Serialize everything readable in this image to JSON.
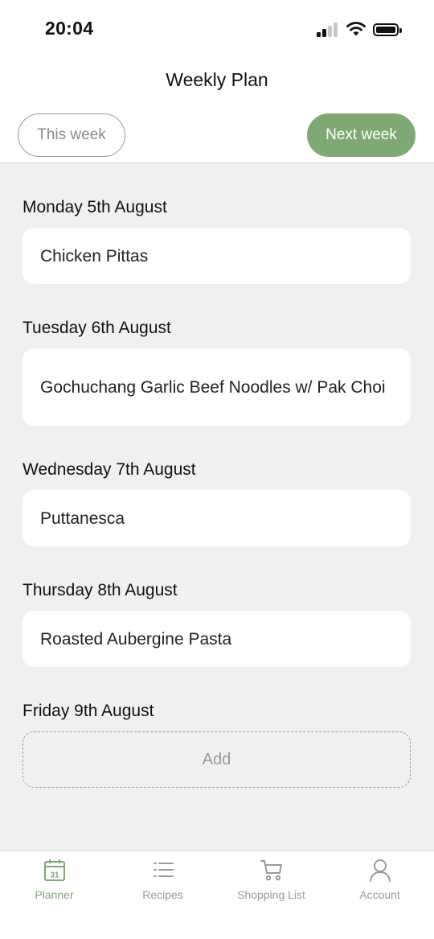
{
  "status_bar": {
    "time": "20:04"
  },
  "header": {
    "title": "Weekly Plan"
  },
  "week_toggle": {
    "this_week": "This week",
    "next_week": "Next week",
    "selected": "Next week"
  },
  "days": [
    {
      "label": "Monday 5th August",
      "meal": "Chicken Pittas"
    },
    {
      "label": "Tuesday 6th August",
      "meal": "Gochuchang Garlic Beef Noodles w/ Pak Choi"
    },
    {
      "label": "Wednesday 7th August",
      "meal": "Puttanesca"
    },
    {
      "label": "Thursday 8th August",
      "meal": "Roasted Aubergine Pasta"
    },
    {
      "label": "Friday 9th August",
      "add_label": "Add"
    }
  ],
  "tabbar": {
    "items": [
      {
        "label": "Planner",
        "icon": "calendar-icon",
        "calendar_day": "31",
        "active": true
      },
      {
        "label": "Recipes",
        "icon": "list-icon",
        "active": false
      },
      {
        "label": "Shopping List",
        "icon": "cart-icon",
        "active": false
      },
      {
        "label": "Account",
        "icon": "user-icon",
        "active": false
      }
    ]
  },
  "colors": {
    "accent": "#7fa874",
    "background": "#f0f0f0",
    "card": "#ffffff",
    "muted": "#9a9a9a"
  }
}
